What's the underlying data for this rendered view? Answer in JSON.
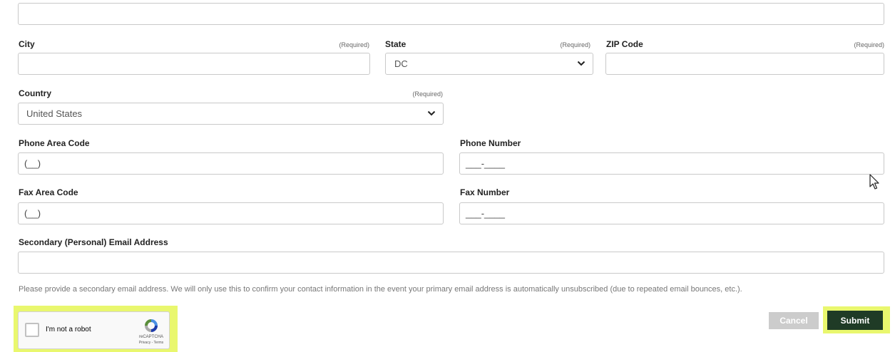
{
  "form": {
    "address_line": {
      "value": ""
    },
    "city": {
      "label": "City",
      "required": "(Required)",
      "value": ""
    },
    "state": {
      "label": "State",
      "required": "(Required)",
      "selected": "DC"
    },
    "zip": {
      "label": "ZIP Code",
      "required": "(Required)",
      "value": ""
    },
    "country": {
      "label": "Country",
      "required": "(Required)",
      "selected": "United States"
    },
    "phone_area": {
      "label": "Phone Area Code",
      "mask": "(__)"
    },
    "phone_number": {
      "label": "Phone Number",
      "mask": "___-____"
    },
    "fax_area": {
      "label": "Fax Area Code",
      "mask": "(__)"
    },
    "fax_number": {
      "label": "Fax Number",
      "mask": "___-____"
    },
    "secondary_email": {
      "label": "Secondary (Personal) Email Address",
      "value": ""
    },
    "help_text": "Please provide a secondary email address. We will only use this to confirm your contact information in the event your primary email address is automatically unsubscribed (due to repeated email bounces, etc.)."
  },
  "recaptcha": {
    "label": "I'm not a robot",
    "brand": "reCAPTCHA",
    "links": "Privacy - Terms"
  },
  "actions": {
    "cancel_label": "Cancel",
    "submit_label": "Submit"
  },
  "colors": {
    "highlight": "#e9f76e",
    "submit_bg": "#1f3b26",
    "cancel_bg": "#cccccc"
  }
}
